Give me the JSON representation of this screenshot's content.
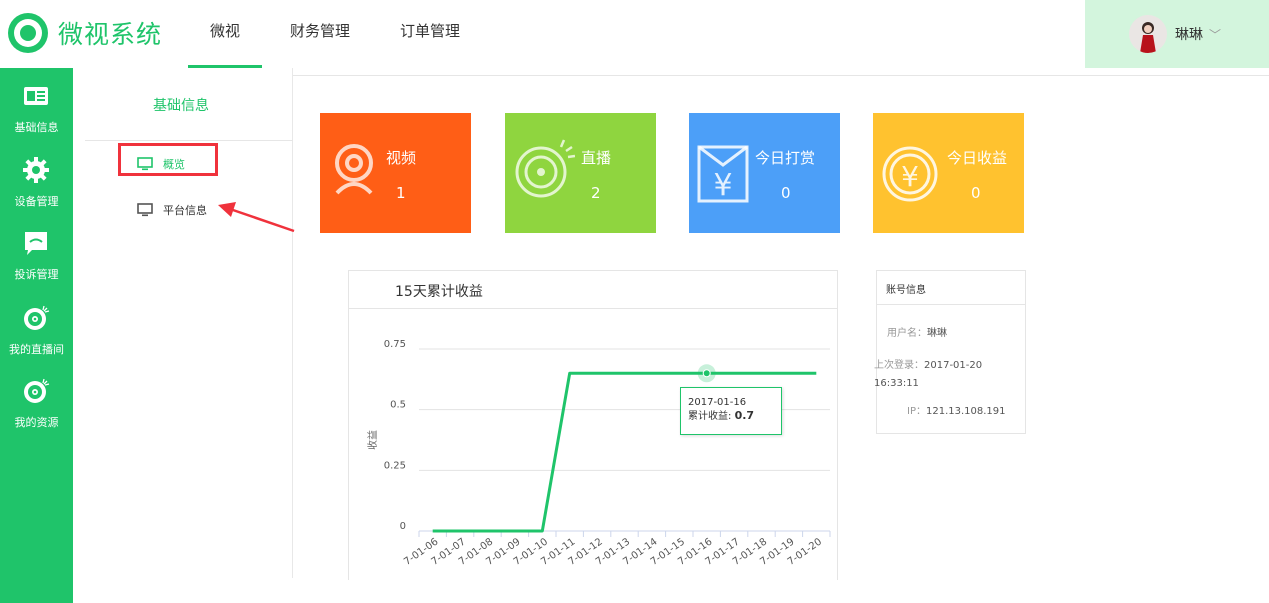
{
  "app": {
    "title": "微视系统"
  },
  "colors": {
    "brand": "#1fc46a",
    "tile_video": "#ff5e16",
    "tile_live": "#8fd53f",
    "tile_reward": "#4c9ff8",
    "tile_income": "#ffc22f",
    "highlight": "#f0323c"
  },
  "topnav": {
    "items": [
      {
        "label": "微视",
        "active": true
      },
      {
        "label": "财务管理"
      },
      {
        "label": "订单管理"
      }
    ]
  },
  "user": {
    "name": "琳琳"
  },
  "sidebar": {
    "items": [
      {
        "label": "基础信息",
        "icon": "id-card-icon",
        "active": true
      },
      {
        "label": "设备管理",
        "icon": "gear-icon"
      },
      {
        "label": "投诉管理",
        "icon": "chat-icon"
      },
      {
        "label": "我的直播间",
        "icon": "disc-icon"
      },
      {
        "label": "我的资源",
        "icon": "disc-icon"
      }
    ]
  },
  "submenu": {
    "title": "基础信息",
    "items": [
      {
        "label": "概览",
        "active": true,
        "icon": "monitor-icon"
      },
      {
        "label": "平台信息",
        "icon": "monitor-icon"
      }
    ]
  },
  "tiles": [
    {
      "label": "视频",
      "value": "1",
      "icon": "camera-icon"
    },
    {
      "label": "直播",
      "value": "2",
      "icon": "disc-icon"
    },
    {
      "label": "今日打赏",
      "value": "0",
      "icon": "yen-envelope-icon"
    },
    {
      "label": "今日收益",
      "value": "0",
      "icon": "yen-coin-icon"
    }
  ],
  "chart_panel": {
    "title": "15天累计收益"
  },
  "chart_data": {
    "type": "line",
    "title": "15天累计收益",
    "ylabel": "收益",
    "ylim": [
      0,
      0.75
    ],
    "yticks": [
      "0",
      "0.25",
      "0.5",
      "0.75"
    ],
    "x": [
      "2017-01-06",
      "2017-01-07",
      "2017-01-08",
      "2017-01-09",
      "2017-01-10",
      "2017-01-11",
      "2017-01-12",
      "2017-01-13",
      "2017-01-14",
      "2017-01-15",
      "2017-01-16",
      "2017-01-17",
      "2017-01-18",
      "2017-01-19",
      "2017-01-20"
    ],
    "xtick_labels": [
      "7-01-06",
      "7-01-07",
      "7-01-08",
      "7-01-09",
      "7-01-10",
      "7-01-11",
      "7-01-12",
      "7-01-13",
      "7-01-14",
      "7-01-15",
      "7-01-16",
      "7-01-17",
      "7-01-18",
      "7-01-19",
      "7-01-20"
    ],
    "series": [
      {
        "values": [
          0,
          0,
          0,
          0,
          0,
          0.65,
          0.65,
          0.65,
          0.65,
          0.65,
          0.65,
          0.65,
          0.65,
          0.65,
          0.65
        ],
        "color": "#1fc46a"
      }
    ],
    "grid": true,
    "highlight_index": 10
  },
  "tooltip": {
    "date": "2017-01-16",
    "label": "累计收益: ",
    "value": "0.7"
  },
  "account": {
    "title": "账号信息",
    "username_label": "用户名：",
    "username": "琳琳",
    "last_login_label": "上次登录：",
    "last_login_date": "2017-01-20",
    "last_login_time": "16:33:11",
    "ip_label": "IP：",
    "ip": "121.13.108.191"
  }
}
